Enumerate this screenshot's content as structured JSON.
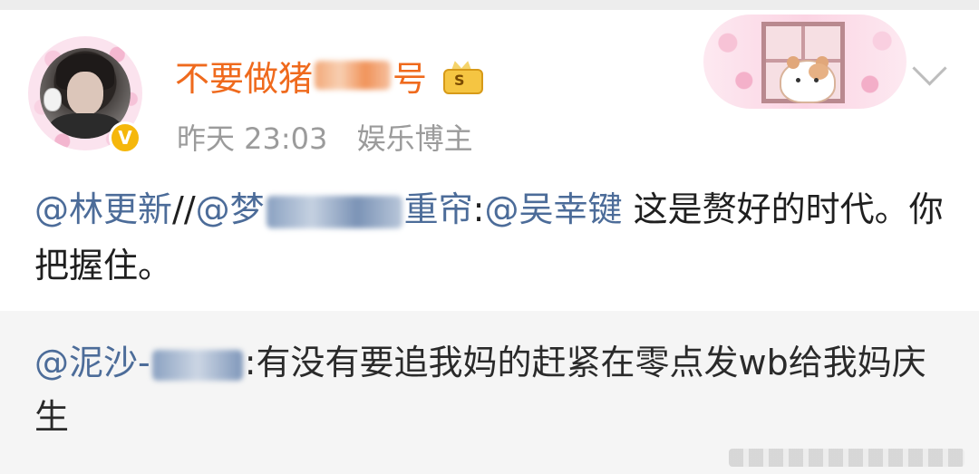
{
  "post": {
    "author": {
      "name_visible_start": "不要做猪",
      "name_visible_end": "号"
    },
    "time": "昨天 23:03",
    "role": "娱乐博主",
    "text": {
      "mention1": "@林更新",
      "sep1": "//",
      "mention2_start": "@梦",
      "mention2_end": "重帘",
      "colon1": ":",
      "mention3": "@吴幸键",
      "content": " 这是赘好的时代。你把握住。"
    }
  },
  "repost": {
    "mention_start": "@泥沙-",
    "colon": ":",
    "content": "有没有要追我妈的赶紧在零点发wb给我妈庆生"
  },
  "colors": {
    "username": "#ef6a1d",
    "mention": "#4c6c99",
    "meta": "#9b9b9b",
    "verified_badge": "#f5b70b"
  }
}
